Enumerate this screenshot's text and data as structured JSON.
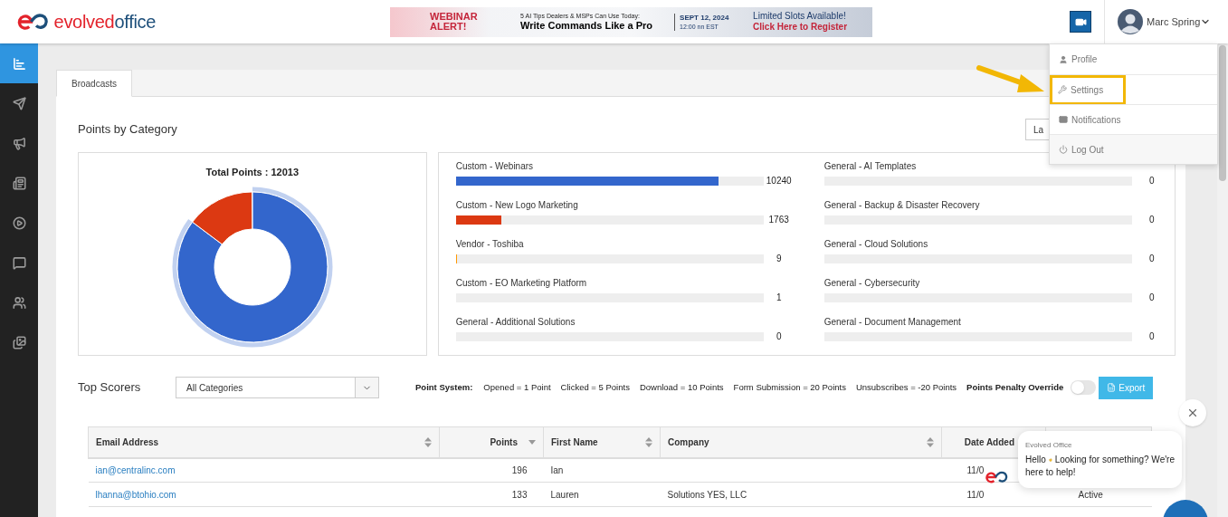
{
  "header": {
    "logo": {
      "word_1": "evolved",
      "word_2": "office"
    },
    "banner": {
      "headline": "WEBINAR ALERT!",
      "kicker": "5 AI Tips Dealers & MSPs Can Use Today:",
      "title": "Write Commands Like a Pro",
      "date": "SEPT 12, 2024",
      "time": "12:00 nn EST",
      "note": "Limited Slots Available!",
      "cta": "Click Here to Register"
    },
    "user": {
      "name": "Marc Spring"
    }
  },
  "user_menu": [
    {
      "label": "Profile",
      "selected": false
    },
    {
      "label": "Settings",
      "selected": true
    },
    {
      "label": "Notifications",
      "selected": false
    },
    {
      "label": "Log Out",
      "selected": false
    }
  ],
  "sidebar": {
    "items": [
      {
        "selected": true
      },
      {
        "selected": false
      },
      {
        "selected": false
      },
      {
        "selected": false
      },
      {
        "selected": false
      },
      {
        "selected": false
      },
      {
        "selected": false
      },
      {
        "selected": false
      }
    ]
  },
  "tabs": [
    {
      "label": "Broadcasts",
      "selected": true
    }
  ],
  "points_by_category": {
    "title": "Points by Category",
    "range_button": "La",
    "total_label": "Total Points : 12013",
    "categories": [
      {
        "name": "Custom - Webinars",
        "value": "10240",
        "level": 0.853,
        "color": "#3366cc"
      },
      {
        "name": "Custom - New Logo Marketing",
        "value": "1763",
        "level": 0.147,
        "color": "#dc3912"
      },
      {
        "name": "Vendor - Toshiba",
        "value": "9",
        "level": 0.004,
        "color": "#ff9900"
      },
      {
        "name": "Custom - EO Marketing Platform",
        "value": "1"
      },
      {
        "name": "General - Additional Solutions",
        "value": "0"
      },
      {
        "name": "General - AI Templates",
        "value": "0"
      },
      {
        "name": "General - Backup & Disaster Recovery",
        "value": "0"
      },
      {
        "name": "General - Cloud Solutions",
        "value": "0"
      },
      {
        "name": "General - Cybersecurity",
        "value": "0"
      },
      {
        "name": "General - Document Management",
        "value": "0"
      }
    ]
  },
  "top_scorers": {
    "title": "Top Scorers",
    "category_select": "All Categories",
    "point_system_label": "Point System:",
    "rules": [
      "Opened = 1 Point",
      "Clicked = 5 Points",
      "Download = 10 Points",
      "Form Submission = 20 Points",
      "Unsubscribes = -20 Points"
    ],
    "penalty_override": {
      "label": "Points Penalty Override",
      "on": false
    },
    "export_button": "Export"
  },
  "table": {
    "columns": [
      {
        "label": "Email Address",
        "sorted_descending": false
      },
      {
        "label": "Points",
        "sorted_descending": true
      },
      {
        "label": "First Name",
        "sorted_descending": false
      },
      {
        "label": "Company",
        "sorted_descending": false
      },
      {
        "label": "Date Added"
      }
    ],
    "rows": [
      {
        "email": "ian@centralinc.com",
        "points": "196",
        "first_name": "Ian",
        "date_added": "11/0"
      },
      {
        "email": "lhanna@btohio.com",
        "points": "133",
        "first_name": "Lauren",
        "company": "Solutions YES, LLC",
        "date_added": "11/0",
        "column_6": "Active"
      }
    ]
  },
  "chat": {
    "sender": "Evolved Office",
    "greeting": "Hello",
    "message_line_1": "Looking for something? We're",
    "message_line_2": "here to help!"
  }
}
